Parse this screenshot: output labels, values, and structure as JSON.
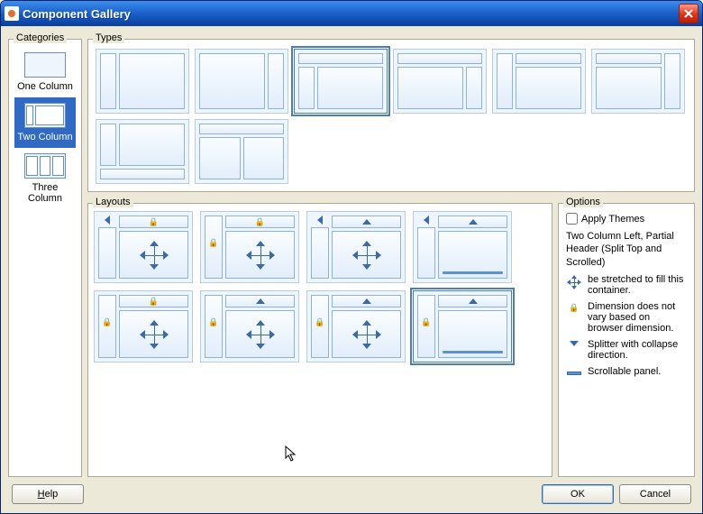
{
  "window": {
    "title": "Component Gallery"
  },
  "sidebar": {
    "label": "Categories",
    "items": [
      {
        "label": "One Column"
      },
      {
        "label": "Two Column"
      },
      {
        "label": "Three Column"
      }
    ],
    "selectedIndex": 1
  },
  "types": {
    "label": "Types",
    "selectedIndex": 2
  },
  "layouts": {
    "label": "Layouts",
    "selectedIndex": 7
  },
  "options": {
    "label": "Options",
    "applyThemesLabel": "Apply Themes",
    "applyThemesChecked": false,
    "description": "Two Column Left, Partial Header (Split Top and Scrolled)",
    "legend": {
      "stretch": "be stretched to fill this container.",
      "lock": "Dimension does not vary based on browser dimension.",
      "splitter": "Splitter with collapse direction.",
      "scroll": "Scrollable panel."
    }
  },
  "buttons": {
    "help": "Help",
    "ok": "OK",
    "cancel": "Cancel"
  }
}
